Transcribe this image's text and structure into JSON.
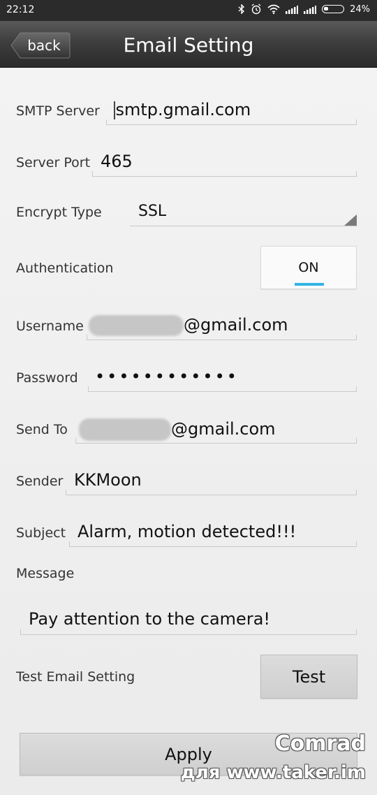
{
  "status_bar": {
    "time": "22:12",
    "battery": "24%",
    "icons": [
      "bluetooth-icon",
      "alarm-icon",
      "wifi-icon",
      "signal-icon",
      "signal-icon",
      "battery-icon"
    ]
  },
  "header": {
    "back_label": "back",
    "title": "Email Setting"
  },
  "form": {
    "smtp_server": {
      "label": "SMTP Server",
      "value": "smtp.gmail.com"
    },
    "server_port": {
      "label": "Server Port",
      "value": "465"
    },
    "encrypt_type": {
      "label": "Encrypt Type",
      "value": "SSL"
    },
    "authentication": {
      "label": "Authentication",
      "value": "ON"
    },
    "username": {
      "label": "Username",
      "value_suffix": "@gmail.com"
    },
    "password": {
      "label": "Password",
      "value": "••••••••••••"
    },
    "send_to": {
      "label": "Send To",
      "value_suffix": "@gmail.com"
    },
    "sender": {
      "label": "Sender",
      "value": "KKMoon"
    },
    "subject": {
      "label": "Subject",
      "value": "Alarm, motion detected!!!"
    },
    "message": {
      "label": "Message",
      "value": "Pay attention to the camera!"
    },
    "test_email": {
      "label": "Test Email Setting",
      "button": "Test"
    },
    "apply_button": "Apply"
  },
  "watermark": {
    "line1": "Comrad",
    "line2": "для www.taker.im"
  },
  "colors": {
    "header_bg": "#3a3a3a",
    "toggle_accent": "#33b5e5",
    "background": "#eeeeee"
  }
}
